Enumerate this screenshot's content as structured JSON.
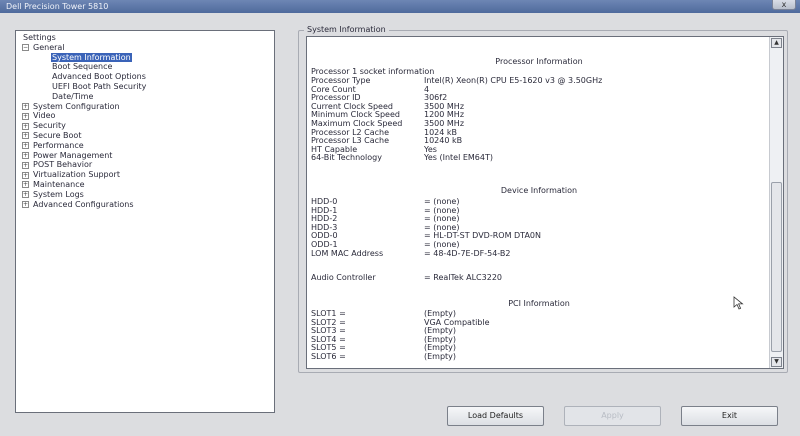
{
  "window": {
    "title": "Dell Precision Tower 5810",
    "close_label": "x"
  },
  "tree": {
    "root": "Settings",
    "general": {
      "label": "General",
      "children": [
        "System Information",
        "Boot Sequence",
        "Advanced Boot Options",
        "UEFI Boot Path Security",
        "Date/Time"
      ]
    },
    "sections": [
      "System Configuration",
      "Video",
      "Security",
      "Secure Boot",
      "Performance",
      "Power Management",
      "POST Behavior",
      "Virtualization Support",
      "Maintenance",
      "System Logs",
      "Advanced Configurations"
    ]
  },
  "panel": {
    "title": "System Information",
    "processor": {
      "heading": "Processor Information",
      "subheading": "Processor 1 socket information",
      "rows": [
        {
          "k": "Processor Type",
          "v": "Intel(R) Xeon(R) CPU E5-1620 v3 @ 3.50GHz"
        },
        {
          "k": "Core Count",
          "v": "4"
        },
        {
          "k": "Processor ID",
          "v": "306f2"
        },
        {
          "k": "Current Clock Speed",
          "v": "3500 MHz"
        },
        {
          "k": "Minimum Clock Speed",
          "v": "1200 MHz"
        },
        {
          "k": "Maximum Clock Speed",
          "v": "3500 MHz"
        },
        {
          "k": "Processor L2 Cache",
          "v": "1024 kB"
        },
        {
          "k": "Processor L3 Cache",
          "v": "10240 kB"
        },
        {
          "k": "HT Capable",
          "v": "Yes"
        },
        {
          "k": "64-Bit Technology",
          "v": "Yes (Intel EM64T)"
        }
      ]
    },
    "device": {
      "heading": "Device Information",
      "rows": [
        {
          "k": "HDD-0",
          "v": "= (none)"
        },
        {
          "k": "HDD-1",
          "v": "= (none)"
        },
        {
          "k": "HDD-2",
          "v": "= (none)"
        },
        {
          "k": "HDD-3",
          "v": "= (none)"
        },
        {
          "k": "ODD-0",
          "v": "= HL-DT-ST DVD-ROM DTA0N"
        },
        {
          "k": "ODD-1",
          "v": "= (none)"
        },
        {
          "k": "LOM MAC Address",
          "v": "= 48-4D-7E-DF-54-B2"
        }
      ],
      "audio": {
        "k": "Audio Controller",
        "v": "= RealTek ALC3220"
      }
    },
    "pci": {
      "heading": "PCI Information",
      "rows": [
        {
          "k": "SLOT1 =",
          "v": "(Empty)"
        },
        {
          "k": "SLOT2 =",
          "v": "VGA Compatible"
        },
        {
          "k": "SLOT3 =",
          "v": "(Empty)"
        },
        {
          "k": "SLOT4 =",
          "v": "(Empty)"
        },
        {
          "k": "SLOT5 =",
          "v": "(Empty)"
        },
        {
          "k": "SLOT6 =",
          "v": "(Empty)"
        }
      ]
    }
  },
  "buttons": {
    "load_defaults": "Load Defaults",
    "apply": "Apply",
    "exit": "Exit"
  },
  "scrollbar": {
    "up": "▲",
    "down": "▼"
  }
}
